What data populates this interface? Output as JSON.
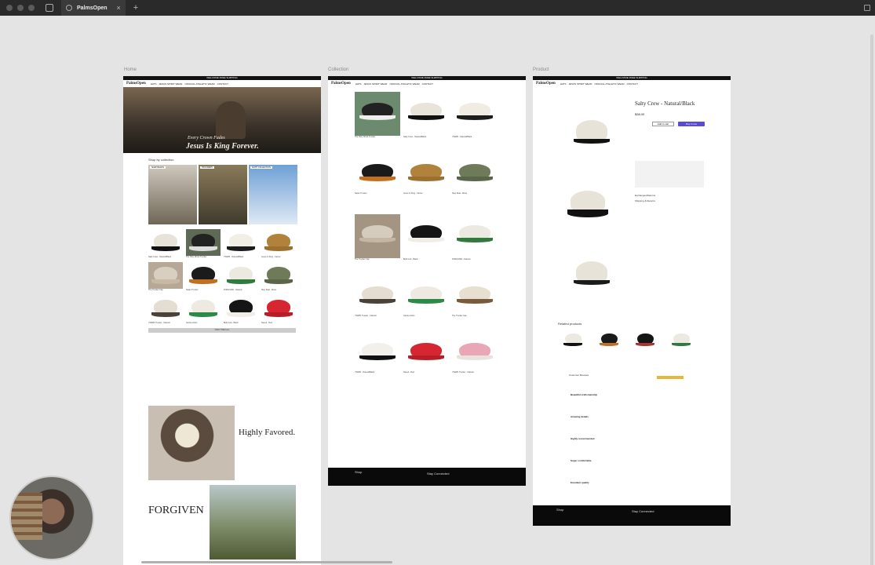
{
  "browser": {
    "tab_title": "PalmsOpen",
    "close_glyph": "×",
    "new_tab_glyph": "+"
  },
  "frames": {
    "home_label": "Home",
    "collection_label": "Collection",
    "product_label": "Product"
  },
  "site": {
    "announcement": "WELCOME FREE SHIPPING",
    "logo": "PalmsOpen",
    "nav": [
      "HATS",
      "JESUS SPIRIT WEAR",
      "OFFICIAL ATHLETIC WEAR",
      "CONTACT"
    ]
  },
  "home": {
    "hero_line1": "Every Crown Fades",
    "hero_line2": "Jesus Is King Forever.",
    "shop_by_collection": "Shop by collection",
    "tiles": [
      "SNAP BACKS",
      "TRUCKERS",
      "FAITH COLLECTION"
    ],
    "view_more": "VIEW THEM ALL",
    "highly_favored": "Highly Favored.",
    "forgiven": "FORGIVEN",
    "product_names": [
      "Salty Crew - Natural/Black",
      "The Holy Ghost Trucker",
      "YWWN - Natural/Black",
      "Jesus Is King - Camel",
      "The Trucker Cap",
      "Satan Trucker",
      "FORGIVEN - Natural",
      "Stay Real - Moss",
      "YWWN Trucker - Natural",
      "Gloria a Dios",
      "Built God - Black",
      "Saved - Red"
    ]
  },
  "collection": {
    "footer_shop": "Shop",
    "footer_stay": "Stay Connected"
  },
  "product": {
    "title": "Salty Crew - Natural/Black",
    "price": "$38.00",
    "add_to_cart": "Add to cart",
    "buy_now": "Buy it now",
    "shipping": "Exchanges/Returns",
    "shipping2": "Shipping & Returns",
    "related": "Related products",
    "reviews": "Customer Reviews",
    "review_titles": [
      "Beautiful craftsmanship",
      "Amazing details",
      "Highly recommended",
      "Super comfortable",
      "Excellent quality"
    ],
    "footer_shop": "Shop",
    "footer_stay": "Stay Connected"
  },
  "colors": {
    "accent_purple": "#5a4bd6",
    "review_gold": "#e8b63a"
  }
}
